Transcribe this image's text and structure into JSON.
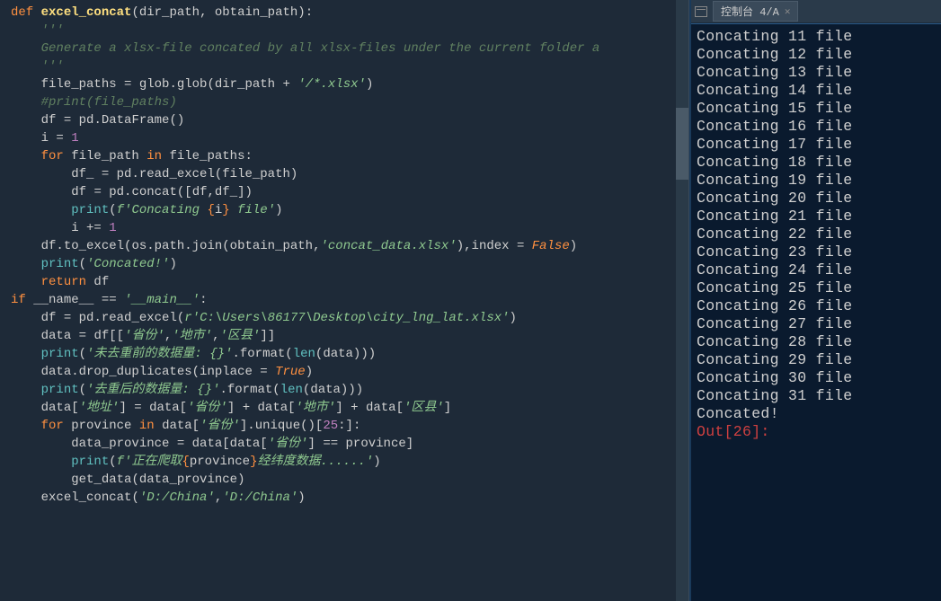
{
  "editor": {
    "tokens": [
      [
        [
          "def ",
          "kw"
        ],
        [
          "excel_concat",
          "fn"
        ],
        [
          "(",
          "punct"
        ],
        [
          "dir_path",
          "param"
        ],
        [
          ", ",
          "punct"
        ],
        [
          "obtain_path",
          "param"
        ],
        [
          "):",
          "punct"
        ]
      ],
      [
        [
          "    ",
          ""
        ],
        [
          "'''",
          "docstr"
        ]
      ],
      [
        [
          "    ",
          ""
        ],
        [
          "Generate a xlsx-file concated by all xlsx-files under the current folder a",
          "docstr"
        ]
      ],
      [
        [
          "    ",
          ""
        ],
        [
          "'''",
          "docstr"
        ]
      ],
      [
        [
          "    ",
          ""
        ],
        [
          "file_paths ",
          "var"
        ],
        [
          "= ",
          "op"
        ],
        [
          "glob.glob",
          "var"
        ],
        [
          "(",
          "punct"
        ],
        [
          "dir_path ",
          "var"
        ],
        [
          "+ ",
          "op"
        ],
        [
          "'/*.xlsx'",
          "str"
        ],
        [
          ")",
          "punct"
        ]
      ],
      [
        [
          "    ",
          ""
        ],
        [
          "#print(file_paths)",
          "comment"
        ]
      ],
      [
        [
          "    ",
          ""
        ],
        [
          "df ",
          "var"
        ],
        [
          "= ",
          "op"
        ],
        [
          "pd.DataFrame",
          "var"
        ],
        [
          "()",
          "punct"
        ]
      ],
      [
        [
          "    ",
          ""
        ],
        [
          "i ",
          "var"
        ],
        [
          "= ",
          "op"
        ],
        [
          "1",
          "num"
        ]
      ],
      [
        [
          "    ",
          ""
        ],
        [
          "for ",
          "kw"
        ],
        [
          "file_path ",
          "var"
        ],
        [
          "in ",
          "kw"
        ],
        [
          "file_paths:",
          "var"
        ]
      ],
      [
        [
          "        ",
          ""
        ],
        [
          "df_ ",
          "var"
        ],
        [
          "= ",
          "op"
        ],
        [
          "pd.read_excel",
          "var"
        ],
        [
          "(",
          "punct"
        ],
        [
          "file_path",
          "var"
        ],
        [
          ")",
          "punct"
        ]
      ],
      [
        [
          "        ",
          ""
        ],
        [
          "df ",
          "var"
        ],
        [
          "= ",
          "op"
        ],
        [
          "pd.concat",
          "var"
        ],
        [
          "([",
          "punct"
        ],
        [
          "df",
          "var"
        ],
        [
          ",",
          "punct"
        ],
        [
          "df_",
          "var"
        ],
        [
          "])",
          "punct"
        ]
      ],
      [
        [
          "        ",
          ""
        ],
        [
          "print",
          "builtin"
        ],
        [
          "(",
          "punct"
        ],
        [
          "f'Concating ",
          "str"
        ],
        [
          "{",
          "fstring-brace"
        ],
        [
          "i",
          "fstring-var"
        ],
        [
          "}",
          "fstring-brace"
        ],
        [
          " file'",
          "str"
        ],
        [
          ")",
          "punct"
        ]
      ],
      [
        [
          "        ",
          ""
        ],
        [
          "i ",
          "var"
        ],
        [
          "+= ",
          "op"
        ],
        [
          "1",
          "num"
        ]
      ],
      [
        [
          "    ",
          ""
        ],
        [
          "df.to_excel",
          "var"
        ],
        [
          "(",
          "punct"
        ],
        [
          "os.path.join",
          "var"
        ],
        [
          "(",
          "punct"
        ],
        [
          "obtain_path",
          "var"
        ],
        [
          ",",
          "punct"
        ],
        [
          "'concat_data.xlsx'",
          "str"
        ],
        [
          "),",
          "punct"
        ],
        [
          "index ",
          "var"
        ],
        [
          "= ",
          "op"
        ],
        [
          "False",
          "bool"
        ],
        [
          ")",
          "punct"
        ]
      ],
      [
        [
          "    ",
          ""
        ],
        [
          "print",
          "builtin"
        ],
        [
          "(",
          "punct"
        ],
        [
          "'Concated!'",
          "str"
        ],
        [
          ")",
          "punct"
        ]
      ],
      [
        [
          "    ",
          ""
        ],
        [
          "return ",
          "kw"
        ],
        [
          "df",
          "var"
        ]
      ],
      [
        [
          "",
          ""
        ]
      ],
      [
        [
          "if ",
          "kw"
        ],
        [
          "__name__ ",
          "var"
        ],
        [
          "== ",
          "op"
        ],
        [
          "'__main__'",
          "str"
        ],
        [
          ":",
          "punct"
        ]
      ],
      [
        [
          "    ",
          ""
        ],
        [
          "df ",
          "var"
        ],
        [
          "= ",
          "op"
        ],
        [
          "pd.read_excel",
          "var"
        ],
        [
          "(",
          "punct"
        ],
        [
          "r'C:\\Users\\86177\\Desktop\\city_lng_lat.xlsx'",
          "str"
        ],
        [
          ")",
          "punct"
        ]
      ],
      [
        [
          "    ",
          ""
        ],
        [
          "data ",
          "var"
        ],
        [
          "= ",
          "op"
        ],
        [
          "df",
          "var"
        ],
        [
          "[[",
          "punct"
        ],
        [
          "'省份'",
          "str"
        ],
        [
          ",",
          "punct"
        ],
        [
          "'地市'",
          "str"
        ],
        [
          ",",
          "punct"
        ],
        [
          "'区县'",
          "str"
        ],
        [
          "]]",
          "punct"
        ]
      ],
      [
        [
          "    ",
          ""
        ],
        [
          "print",
          "builtin"
        ],
        [
          "(",
          "punct"
        ],
        [
          "'未去重前的数据量: ",
          "str"
        ],
        [
          "{}",
          "str"
        ],
        [
          "'",
          "str"
        ],
        [
          ".format",
          "var"
        ],
        [
          "(",
          "punct"
        ],
        [
          "len",
          "builtin"
        ],
        [
          "(",
          "punct"
        ],
        [
          "data",
          "var"
        ],
        [
          ")))",
          "punct"
        ]
      ],
      [
        [
          "    ",
          ""
        ],
        [
          "data.drop_duplicates",
          "var"
        ],
        [
          "(",
          "punct"
        ],
        [
          "inplace ",
          "var"
        ],
        [
          "= ",
          "op"
        ],
        [
          "True",
          "bool"
        ],
        [
          ")",
          "punct"
        ]
      ],
      [
        [
          "    ",
          ""
        ],
        [
          "print",
          "builtin"
        ],
        [
          "(",
          "punct"
        ],
        [
          "'去重后的数据量: ",
          "str"
        ],
        [
          "{}",
          "str"
        ],
        [
          "'",
          "str"
        ],
        [
          ".format",
          "var"
        ],
        [
          "(",
          "punct"
        ],
        [
          "len",
          "builtin"
        ],
        [
          "(",
          "punct"
        ],
        [
          "data",
          "var"
        ],
        [
          ")))",
          "punct"
        ]
      ],
      [
        [
          "    ",
          ""
        ],
        [
          "data",
          "var"
        ],
        [
          "[",
          "punct"
        ],
        [
          "'地址'",
          "str"
        ],
        [
          "] ",
          "punct"
        ],
        [
          "= ",
          "op"
        ],
        [
          "data",
          "var"
        ],
        [
          "[",
          "punct"
        ],
        [
          "'省份'",
          "str"
        ],
        [
          "] ",
          "punct"
        ],
        [
          "+ ",
          "op"
        ],
        [
          "data",
          "var"
        ],
        [
          "[",
          "punct"
        ],
        [
          "'地市'",
          "str"
        ],
        [
          "] ",
          "punct"
        ],
        [
          "+ ",
          "op"
        ],
        [
          "data",
          "var"
        ],
        [
          "[",
          "punct"
        ],
        [
          "'区县'",
          "str"
        ],
        [
          "]",
          "punct"
        ]
      ],
      [
        [
          "    ",
          ""
        ],
        [
          "for ",
          "kw"
        ],
        [
          "province ",
          "var"
        ],
        [
          "in ",
          "kw"
        ],
        [
          "data",
          "var"
        ],
        [
          "[",
          "punct"
        ],
        [
          "'省份'",
          "str"
        ],
        [
          "].",
          "punct"
        ],
        [
          "unique",
          "var"
        ],
        [
          "()[",
          "punct"
        ],
        [
          "25",
          "num"
        ],
        [
          ":]:",
          "punct"
        ]
      ],
      [
        [
          "        ",
          ""
        ],
        [
          "data_province ",
          "var"
        ],
        [
          "= ",
          "op"
        ],
        [
          "data",
          "var"
        ],
        [
          "[",
          "punct"
        ],
        [
          "data",
          "var"
        ],
        [
          "[",
          "punct"
        ],
        [
          "'省份'",
          "str"
        ],
        [
          "] ",
          "punct"
        ],
        [
          "== ",
          "op"
        ],
        [
          "province",
          "var"
        ],
        [
          "]",
          "punct"
        ]
      ],
      [
        [
          "        ",
          ""
        ],
        [
          "print",
          "builtin"
        ],
        [
          "(",
          "punct"
        ],
        [
          "f'正在爬取",
          "str"
        ],
        [
          "{",
          "fstring-brace"
        ],
        [
          "province",
          "fstring-var"
        ],
        [
          "}",
          "fstring-brace"
        ],
        [
          "经纬度数据......'",
          "str"
        ],
        [
          ")",
          "punct"
        ]
      ],
      [
        [
          "        ",
          ""
        ],
        [
          "get_data",
          "var"
        ],
        [
          "(",
          "punct"
        ],
        [
          "data_province",
          "var"
        ],
        [
          ")",
          "punct"
        ]
      ],
      [
        [
          "",
          ""
        ]
      ],
      [
        [
          "    ",
          ""
        ],
        [
          "excel_concat",
          "var"
        ],
        [
          "(",
          "punct"
        ],
        [
          "'D:/China'",
          "str"
        ],
        [
          ",",
          "punct"
        ],
        [
          "'D:/China'",
          "str"
        ],
        [
          ")",
          "punct"
        ]
      ]
    ]
  },
  "console": {
    "tab_label": "控制台 4/A",
    "lines": [
      "Concating 11 file",
      "Concating 12 file",
      "Concating 13 file",
      "Concating 14 file",
      "Concating 15 file",
      "Concating 16 file",
      "Concating 17 file",
      "Concating 18 file",
      "Concating 19 file",
      "Concating 20 file",
      "Concating 21 file",
      "Concating 22 file",
      "Concating 23 file",
      "Concating 24 file",
      "Concating 25 file",
      "Concating 26 file",
      "Concating 27 file",
      "Concating 28 file",
      "Concating 29 file",
      "Concating 30 file",
      "Concating 31 file",
      "Concated!"
    ],
    "out_prompt": "Out[26]:"
  }
}
